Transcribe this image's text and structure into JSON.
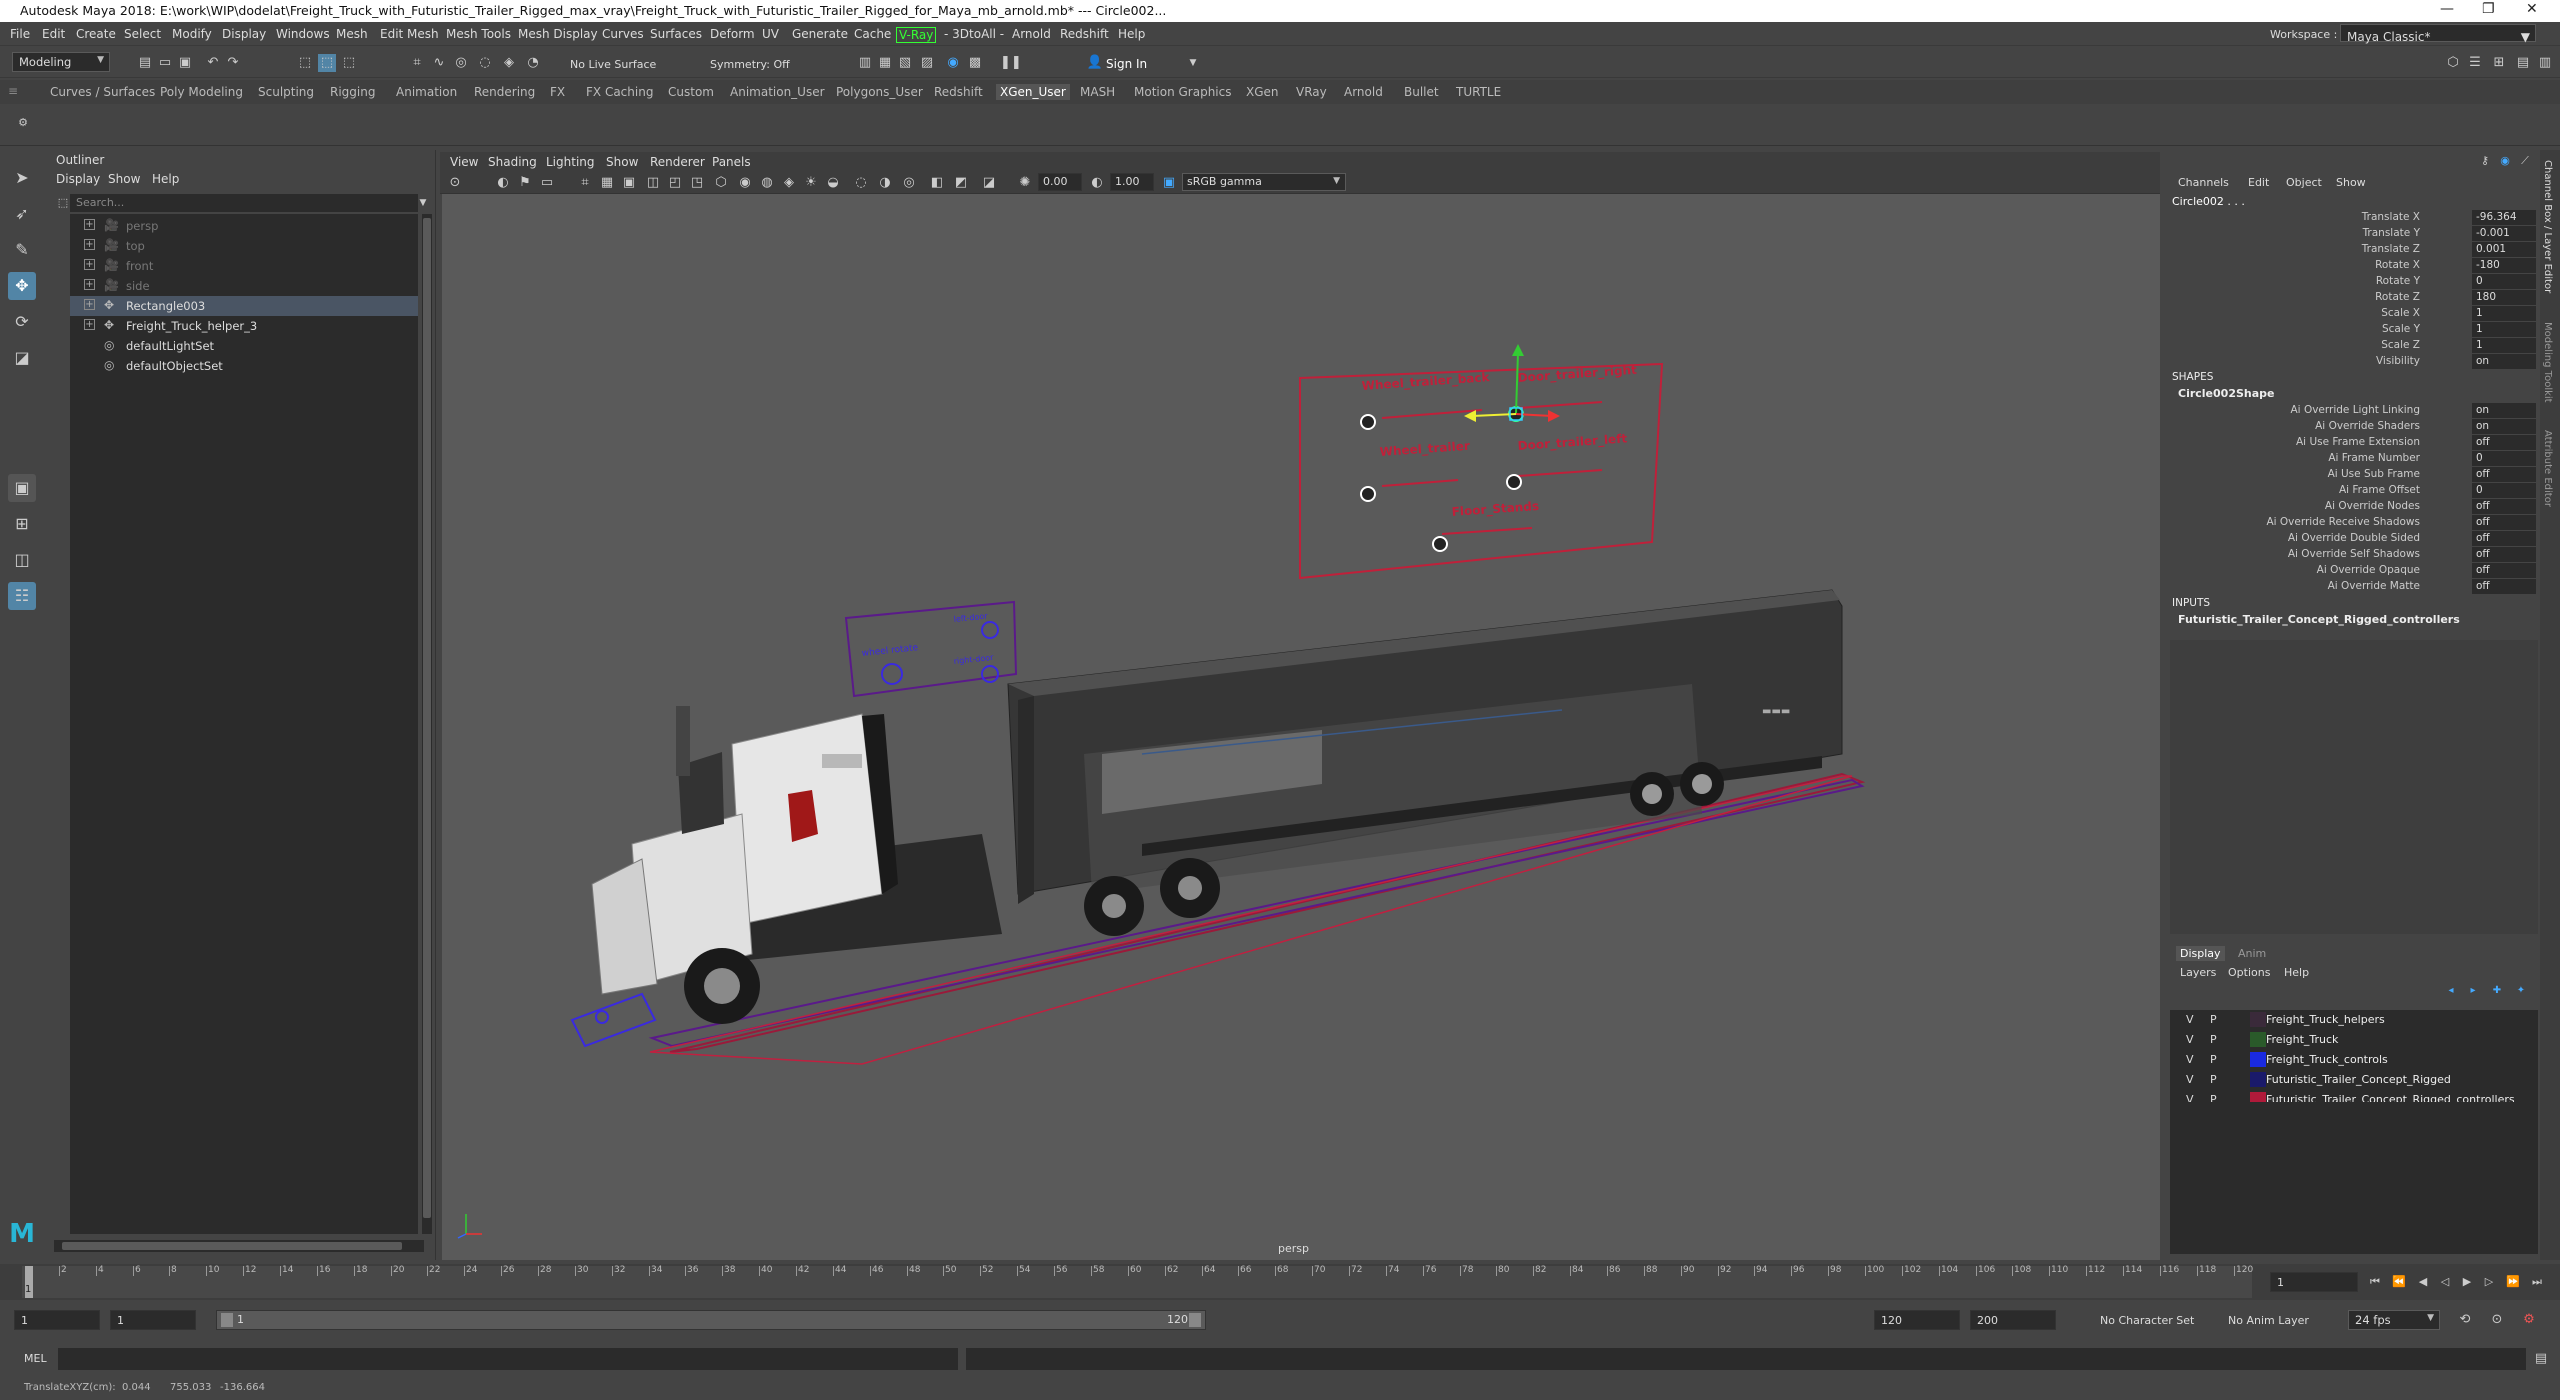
{
  "window": {
    "title": "Autodesk Maya 2018: E:\\work\\WIP\\dodelat\\Freight_Truck_with_Futuristic_Trailer_Rigged_max_vray\\Freight_Truck_with_Futuristic_Trailer_Rigged_for_Maya_mb_arnold.mb*  ---  Circle002...",
    "minimize": "—",
    "maximize": "❐",
    "close": "✕"
  },
  "menubar": {
    "items": [
      "File",
      "Edit",
      "Create",
      "Select",
      "Modify",
      "Display",
      "Windows",
      "Mesh",
      "Edit Mesh",
      "Mesh Tools",
      "Mesh Display",
      "Curves",
      "Surfaces",
      "Deform",
      "UV",
      "Generate",
      "Cache",
      "V-Ray",
      "- 3DtoAll -",
      "Arnold",
      "Redshift",
      "Help"
    ],
    "workspace_label": "Workspace :",
    "workspace_value": "Maya Classic*"
  },
  "statusline": {
    "mode": "Modeling",
    "live_surface": "No Live Surface",
    "symmetry": "Symmetry: Off",
    "sign_in": "Sign In"
  },
  "shelf": {
    "tabs": [
      "Curves / Surfaces",
      "Poly Modeling",
      "Sculpting",
      "Rigging",
      "Animation",
      "Rendering",
      "FX",
      "FX Caching",
      "Custom",
      "Animation_User",
      "Polygons_User",
      "Redshift",
      "XGen_User",
      "MASH",
      "Motion Graphics",
      "XGen",
      "VRay",
      "Arnold",
      "Bullet",
      "TURTLE"
    ],
    "active": "XGen_User"
  },
  "outliner": {
    "title": "Outliner",
    "menu": [
      "Display",
      "Show",
      "Help"
    ],
    "search_placeholder": "Search...",
    "items": [
      {
        "name": "persp",
        "icon": "camera-icon",
        "expand": "+",
        "dim": true
      },
      {
        "name": "top",
        "icon": "camera-icon",
        "expand": "+",
        "dim": true
      },
      {
        "name": "front",
        "icon": "camera-icon",
        "expand": "+",
        "dim": true
      },
      {
        "name": "side",
        "icon": "camera-icon",
        "expand": "+",
        "dim": true
      },
      {
        "name": "Rectangle003",
        "icon": "transform-icon",
        "expand": "+",
        "selected": true
      },
      {
        "name": "Freight_Truck_helper_3",
        "icon": "transform-icon",
        "expand": "+"
      },
      {
        "name": "defaultLightSet",
        "icon": "set-icon",
        "expand": ""
      },
      {
        "name": "defaultObjectSet",
        "icon": "set-icon",
        "expand": ""
      }
    ]
  },
  "viewport": {
    "menu": [
      "View",
      "Shading",
      "Lighting",
      "Show",
      "Renderer",
      "Panels"
    ],
    "exposure": "0.00",
    "gamma": "1.00",
    "color_space": "sRGB gamma",
    "camera_label": "persp",
    "controllers_top": [
      "Wheel_trailer_back",
      "Door_trailer_right",
      "Wheel_trailer",
      "Door_trailer_left",
      "Floor_Stands"
    ],
    "controllers_cab": [
      "left-door",
      "wheel rotate",
      "right-door"
    ],
    "trailer_brand": "▬▬▬"
  },
  "channelbox": {
    "menu": [
      "Channels",
      "Edit",
      "Object",
      "Show"
    ],
    "object": "Circle002 . . .",
    "channels": [
      {
        "label": "Translate X",
        "value": "-96.364"
      },
      {
        "label": "Translate Y",
        "value": "-0.001"
      },
      {
        "label": "Translate Z",
        "value": "0.001"
      },
      {
        "label": "Rotate X",
        "value": "-180"
      },
      {
        "label": "Rotate Y",
        "value": "0"
      },
      {
        "label": "Rotate Z",
        "value": "180"
      },
      {
        "label": "Scale X",
        "value": "1"
      },
      {
        "label": "Scale Y",
        "value": "1"
      },
      {
        "label": "Scale Z",
        "value": "1"
      },
      {
        "label": "Visibility",
        "value": "on"
      }
    ],
    "shapes_header": "SHAPES",
    "shape_name": "Circle002Shape",
    "shape_attrs": [
      {
        "label": "Ai Override Light Linking",
        "value": "on"
      },
      {
        "label": "Ai Override Shaders",
        "value": "on"
      },
      {
        "label": "Ai Use Frame Extension",
        "value": "off"
      },
      {
        "label": "Ai Frame Number",
        "value": "0"
      },
      {
        "label": "Ai Use Sub Frame",
        "value": "off"
      },
      {
        "label": "Ai Frame Offset",
        "value": "0"
      },
      {
        "label": "Ai Override Nodes",
        "value": "off"
      },
      {
        "label": "Ai Override Receive Shadows",
        "value": "off"
      },
      {
        "label": "Ai Override Double Sided",
        "value": "off"
      },
      {
        "label": "Ai Override Self Shadows",
        "value": "off"
      },
      {
        "label": "Ai Override Opaque",
        "value": "off"
      },
      {
        "label": "Ai Override Matte",
        "value": "off"
      }
    ],
    "inputs_header": "INPUTS",
    "input_name": "Futuristic_Trailer_Concept_Rigged_controllers"
  },
  "layers": {
    "tabs": [
      "Display",
      "Anim"
    ],
    "menu": [
      "Layers",
      "Options",
      "Help"
    ],
    "rows": [
      {
        "v": "V",
        "p": "P",
        "color": "#3a2a3a",
        "name": "Freight_Truck_helpers"
      },
      {
        "v": "V",
        "p": "P",
        "color": "#2a5a2a",
        "name": "Freight_Truck"
      },
      {
        "v": "V",
        "p": "P",
        "color": "#1a2ae0",
        "name": "Freight_Truck_controls"
      },
      {
        "v": "V",
        "p": "P",
        "color": "#1a1a6a",
        "name": "Futuristic_Trailer_Concept_Rigged"
      },
      {
        "v": "V",
        "p": "P",
        "color": "#b01a3a",
        "name": "Futuristic_Trailer_Concept_Rigged_controllers"
      }
    ]
  },
  "right_strip": [
    "Channel Box / Layer Editor",
    "Modeling Toolkit",
    "Attribute Editor"
  ],
  "timeline": {
    "ticks": [
      "2",
      "4",
      "6",
      "8",
      "10",
      "12",
      "14",
      "16",
      "18",
      "20",
      "22",
      "24",
      "26",
      "28",
      "30",
      "32",
      "34",
      "36",
      "38",
      "40",
      "42",
      "44",
      "46",
      "48",
      "50",
      "52",
      "54",
      "56",
      "58",
      "60",
      "62",
      "64",
      "66",
      "68",
      "70",
      "72",
      "74",
      "76",
      "78",
      "80",
      "82",
      "84",
      "86",
      "88",
      "90",
      "92",
      "94",
      "96",
      "98",
      "100",
      "102",
      "104",
      "106",
      "108",
      "110",
      "112",
      "114",
      "116",
      "118",
      "120"
    ],
    "current_frame": "1"
  },
  "range": {
    "start": "1",
    "start2": "1",
    "range_start": "1",
    "range_end": "120",
    "end": "120",
    "end2": "200",
    "char_set": "No Character Set",
    "anim_layer": "No Anim Layer",
    "fps": "24 fps"
  },
  "cmd": {
    "label": "MEL"
  },
  "help": {
    "text": "TranslateXYZ(cm):",
    "x": "0.044",
    "y": "755.033",
    "z": "-136.664"
  }
}
